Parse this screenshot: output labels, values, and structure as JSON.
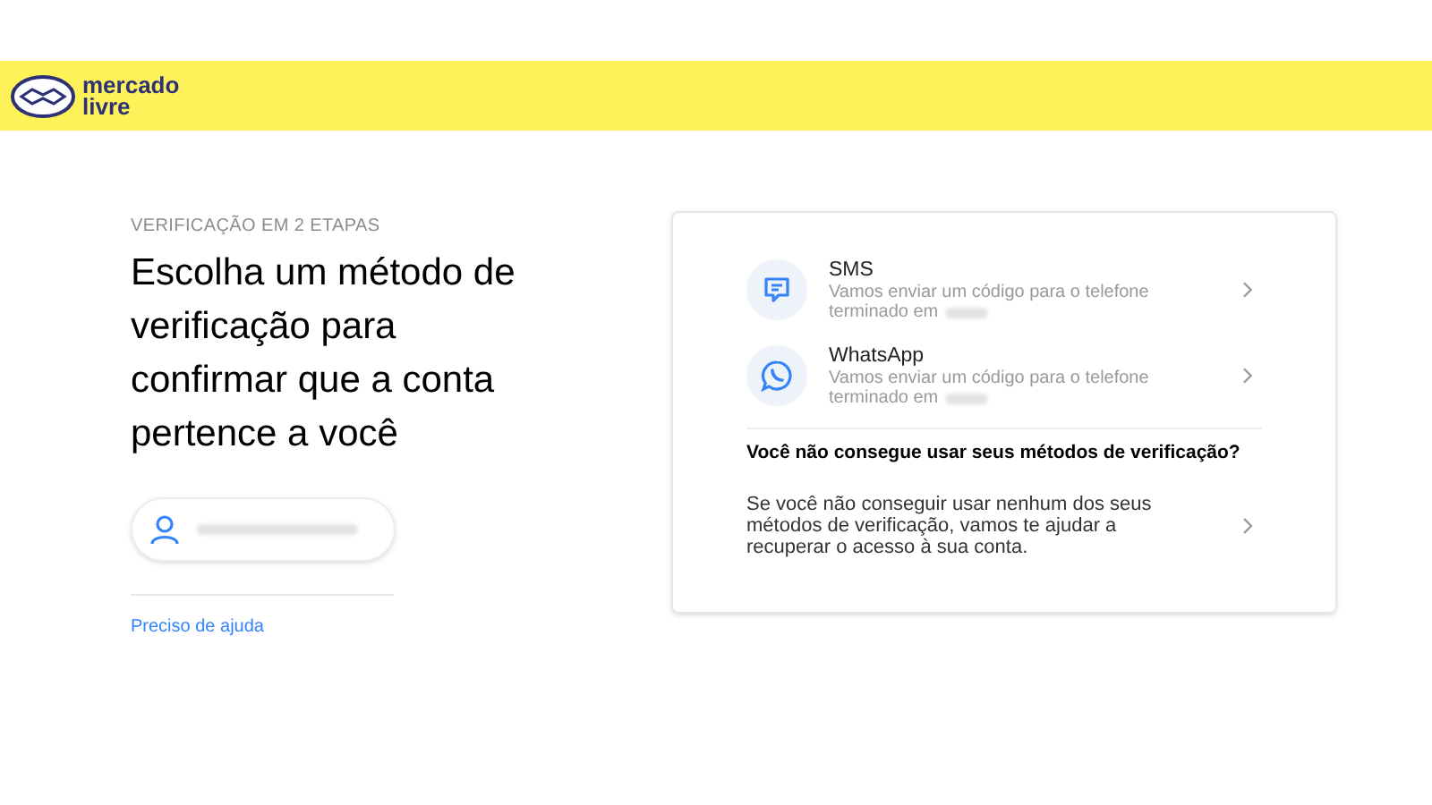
{
  "header": {
    "logo_line_1": "mercado",
    "logo_line_2": "livre"
  },
  "step_label": "VERIFICAÇÃO EM 2 ETAPAS",
  "heading": "Escolha um método de verificação para confirmar que a conta pertence a você",
  "help_link": "Preciso de ajuda",
  "methods": [
    {
      "kind": "sms",
      "title": "SMS",
      "description_line_1": "Vamos enviar um código para o telefone",
      "description_line_2": "terminado em"
    },
    {
      "kind": "whatsapp",
      "title": "WhatsApp",
      "description_line_1": "Vamos enviar um código para o telefone",
      "description_line_2": "terminado em"
    }
  ],
  "recovery": {
    "question": "Você não consegue usar seus métodos de verificação?",
    "text": "Se você não conseguir usar nenhum dos seus métodos de verificação, vamos te ajudar a recuperar o acesso à sua conta."
  }
}
